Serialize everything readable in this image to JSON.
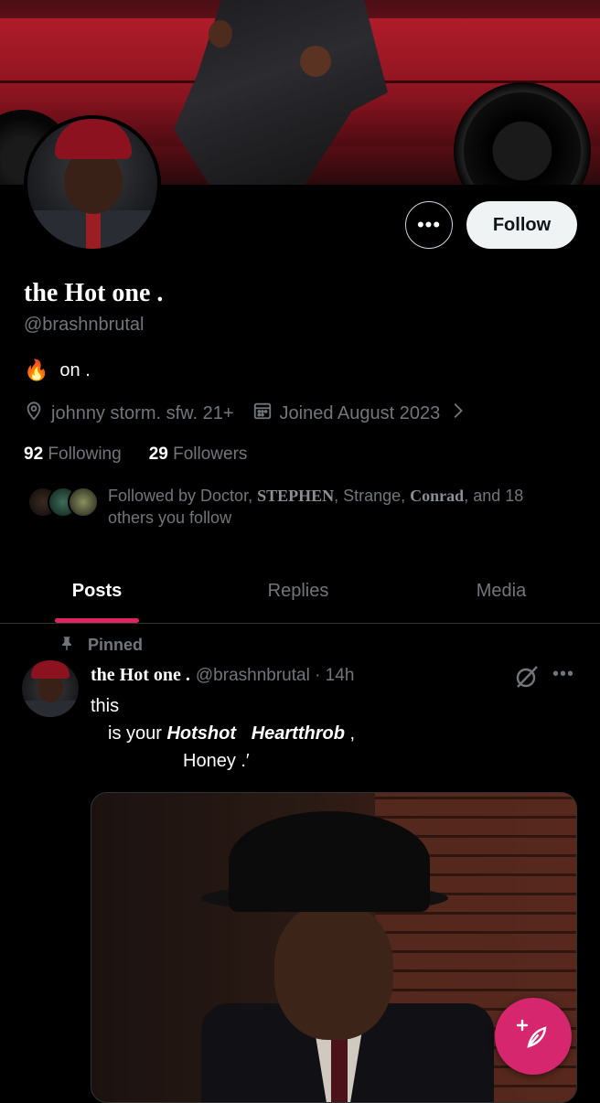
{
  "profile": {
    "display_name": "the Hot one .",
    "handle": "@brashnbrutal",
    "bio_emoji": "🔥",
    "bio_text": "on .",
    "location": "johnny  storm.  sfw.  21+",
    "joined": "Joined August 2023",
    "following_count": "92",
    "following_label": "Following",
    "followers_count": "29",
    "followers_label": "Followers",
    "followed_by": {
      "prefix": "Followed by Doctor, ",
      "name1": "STEPHEN",
      "mid": ", Strange, ",
      "name2": "Conrad",
      "suffix": ", and 18 others you follow"
    }
  },
  "actions": {
    "more_label": "•••",
    "follow_label": "Follow"
  },
  "tabs": [
    "Posts",
    "Replies",
    "Media"
  ],
  "post": {
    "pinned_label": "Pinned",
    "author": "the Hot one .",
    "handle_time": "@brashnbrutal · 14h",
    "more_label": "•••",
    "line1": "this",
    "line2_prefix": "is  your  ",
    "line2_bold1": "Hotshot",
    "line2_bold2": "Heartthrob",
    "line2_suffix": " ,",
    "line3": "Honey  .′"
  },
  "colors": {
    "accent": "#e0245e",
    "fab": "#d6276e",
    "muted": "#71767b"
  },
  "icons": [
    "location-icon",
    "calendar-icon",
    "chevron-right-icon",
    "pin-icon",
    "grok-icon",
    "compose-icon"
  ]
}
